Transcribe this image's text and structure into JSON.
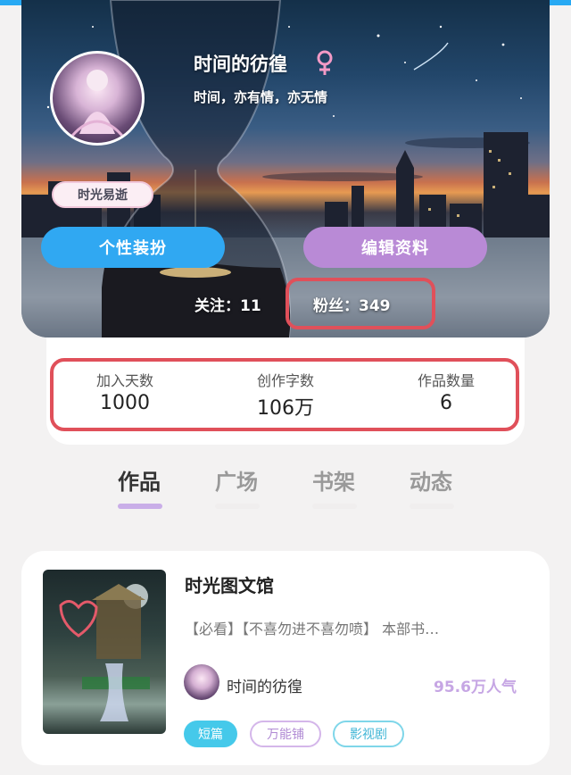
{
  "profile": {
    "username": "时间的彷徨",
    "gender_icon": "female-icon",
    "signature": "时间，亦有情，亦无情",
    "badge": "时光易逝",
    "buttons": {
      "dress_up": "个性装扮",
      "edit_profile": "编辑资料"
    },
    "follow": {
      "following": "关注：11",
      "fans": "粉丝：349"
    }
  },
  "stats": [
    {
      "label": "加入天数",
      "value": "1000"
    },
    {
      "label": "创作字数",
      "value": "106万"
    },
    {
      "label": "作品数量",
      "value": "6"
    }
  ],
  "tabs": [
    {
      "label": "作品",
      "active": true
    },
    {
      "label": "广场",
      "active": false
    },
    {
      "label": "书架",
      "active": false
    },
    {
      "label": "动态",
      "active": false
    }
  ],
  "work": {
    "title": "时光图文馆",
    "description": "【必看】【不喜勿进不喜勿喷】 本部书…",
    "author": "时间的彷徨",
    "popularity": "95.6万人气",
    "tags": [
      "短篇",
      "万能铺",
      "影视剧"
    ]
  },
  "colors": {
    "accent_blue": "#30a8f2",
    "accent_purple": "#b98ad6",
    "highlight_red": "#e0505a",
    "popularity_purple": "#c6a6e4",
    "tag_cyan": "#45c9ea"
  }
}
